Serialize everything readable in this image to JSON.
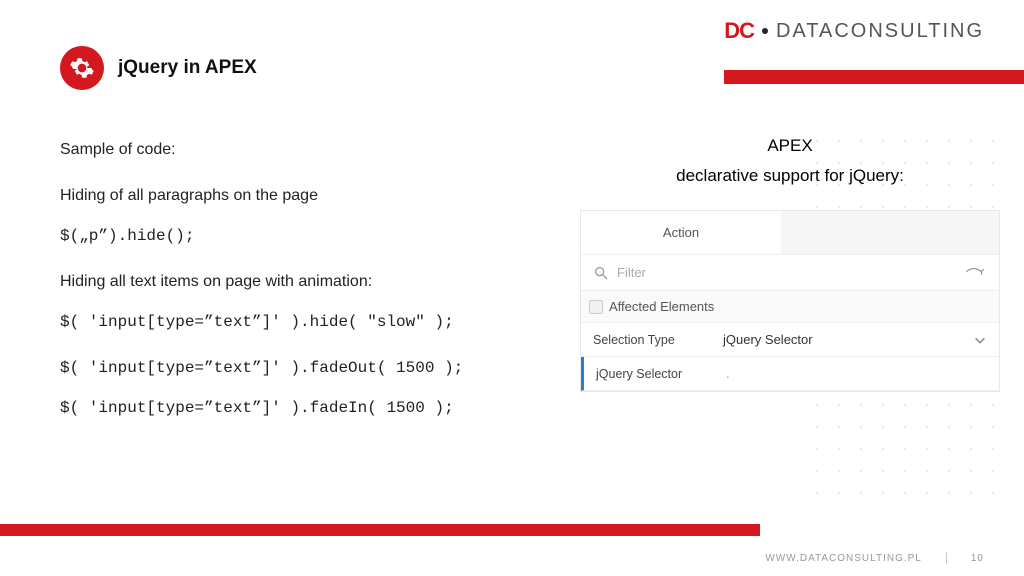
{
  "logo": {
    "dc": "DC",
    "brand": "DATACONSULTING"
  },
  "title": "jQuery in APEX",
  "left": {
    "sample": "Sample of code:",
    "hide_para": "Hiding of all paragraphs on the page",
    "code1": "$(„p”).hide();",
    "hide_anim": "Hiding all text items on page with animation:",
    "code2": "$( 'input[type=”text”]' ).hide( \"slow\" );",
    "code3": "$( 'input[type=”text”]' ).fadeOut( 1500 );",
    "code4": "$( 'input[type=”text”]' ).fadeIn( 1500 );"
  },
  "right": {
    "apex": "APEX",
    "subtitle": "declarative support for jQuery:",
    "action_label": "Action",
    "filter_placeholder": "Filter",
    "section": "Affected Elements",
    "sel_type_label": "Selection Type",
    "sel_type_value": "jQuery Selector",
    "jq_label": "jQuery Selector",
    "jq_value": "."
  },
  "footer": {
    "url": "WWW.DATACONSULTING.PL",
    "page": "10"
  }
}
